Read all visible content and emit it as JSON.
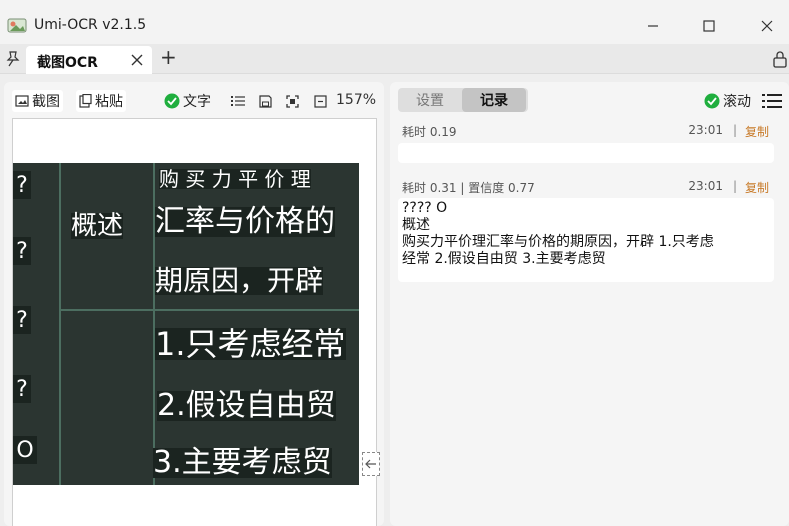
{
  "window": {
    "title": "Umi-OCR v2.1.5",
    "min_glyph": "—",
    "max_glyph": "☐",
    "close_glyph": "✕"
  },
  "tabs": {
    "pin_glyph": "⚲",
    "active_tab": "截图OCR",
    "close_glyph": "✕",
    "add_glyph": "+"
  },
  "left_toolbar": {
    "screenshot_label": "截图",
    "paste_label": "粘贴",
    "text_label": "文字",
    "zoom": "157%"
  },
  "ocr_image": {
    "heading": "购 买 力 平 价 理",
    "section": "概述",
    "line1": "汇率与价格的",
    "line2": "期原因，开辟",
    "item1": "1.只考虑经常",
    "item2": "2.假设自由贸",
    "item3": "3.主要考虑贸",
    "markers": [
      "?",
      "?",
      "?",
      "?",
      "O"
    ]
  },
  "right_panel": {
    "tab_settings": "设置",
    "tab_records": "记录",
    "scroll_label": "滚动"
  },
  "records": [
    {
      "meta": "耗时 0.19",
      "time": "23:01",
      "sep": "|",
      "copy": "复制",
      "lines": []
    },
    {
      "meta": "耗时 0.31 | 置信度 0.77",
      "time": "23:01",
      "sep": "|",
      "copy": "复制",
      "lines": [
        "???? O",
        "概述",
        "购买力平价理汇率与价格的期原因，开辟 1.只考虑",
        "经常 2.假设自由贸 3.主要考虑贸"
      ]
    }
  ],
  "colors": {
    "check_green": "#1fae3e",
    "copy_orange": "#c87a28"
  }
}
